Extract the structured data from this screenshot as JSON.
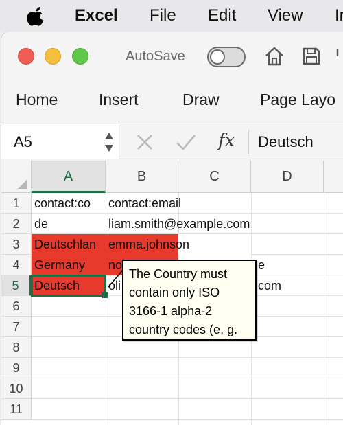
{
  "menubar": {
    "app_name": "Excel",
    "items": [
      "File",
      "Edit",
      "View",
      "Ir"
    ]
  },
  "titlebar": {
    "autosave_label": "AutoSave",
    "autosave_on": false
  },
  "ribbon": {
    "tabs": [
      "Home",
      "Insert",
      "Draw",
      "Page Layo"
    ]
  },
  "formula_bar": {
    "name_box": "A5",
    "fx_symbol": "fx",
    "value": "Deutsch"
  },
  "sheet": {
    "columns": [
      "A",
      "B",
      "C",
      "D"
    ],
    "selected_column": "A",
    "rows": [
      "1",
      "2",
      "3",
      "4",
      "5",
      "6",
      "7",
      "8",
      "9",
      "10",
      "11"
    ],
    "selected_row": "5",
    "cells": {
      "A1": "contact:co",
      "B1": "contact:email",
      "A2": "de",
      "B2": "liam.smith@example.com",
      "A3": "Deutschlan",
      "B3": "emma.johnson",
      "A4": "Germany",
      "B4": "no",
      "C4": "e",
      "A5": "Deutsch",
      "B5": "oli",
      "C5": "com"
    },
    "invalid_fill": "#e8392d",
    "selection_color": "#1e7145"
  },
  "tooltip": {
    "text": "The Country must contain only ISO 3166-1 alpha-2 country codes (e. g."
  }
}
